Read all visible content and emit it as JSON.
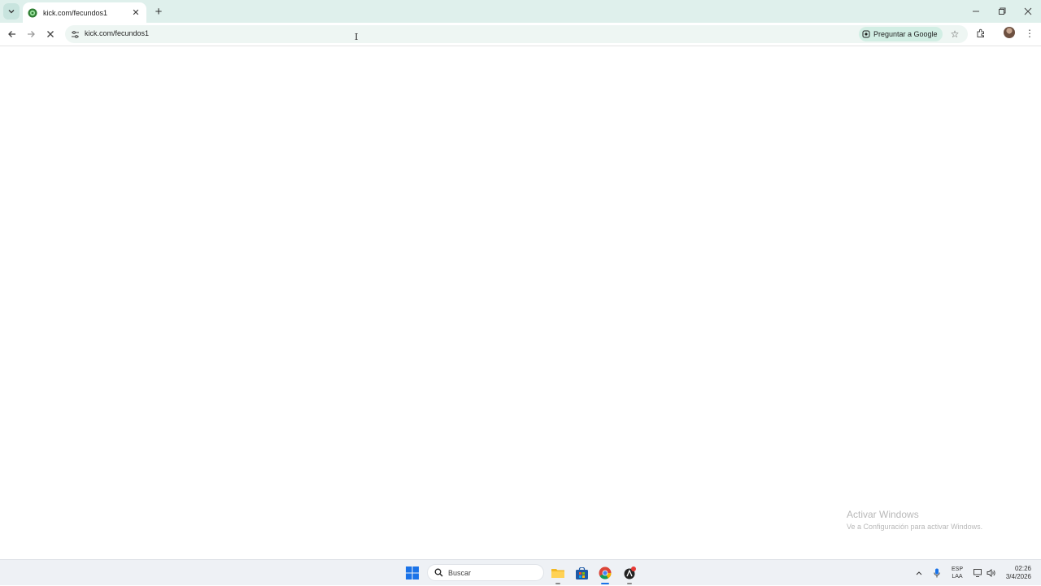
{
  "browser": {
    "tab": {
      "title": "kick.com/fecundos1",
      "favicon": "kick-favicon-icon"
    },
    "new_tab_label": "+",
    "address_bar": {
      "url": "kick.com/fecundos1"
    },
    "ask_google_label": "Preguntar a Google",
    "accent_color": "#dff0ec"
  },
  "page": {
    "watermark": {
      "title": "Activar Windows",
      "subtitle": "Ve a Configuración para activar Windows."
    }
  },
  "taskbar": {
    "search_placeholder": "Buscar",
    "language": {
      "line1": "ESP",
      "line2": "LAA"
    },
    "clock": {
      "time": "02:26",
      "date": "3/4/2026"
    }
  }
}
